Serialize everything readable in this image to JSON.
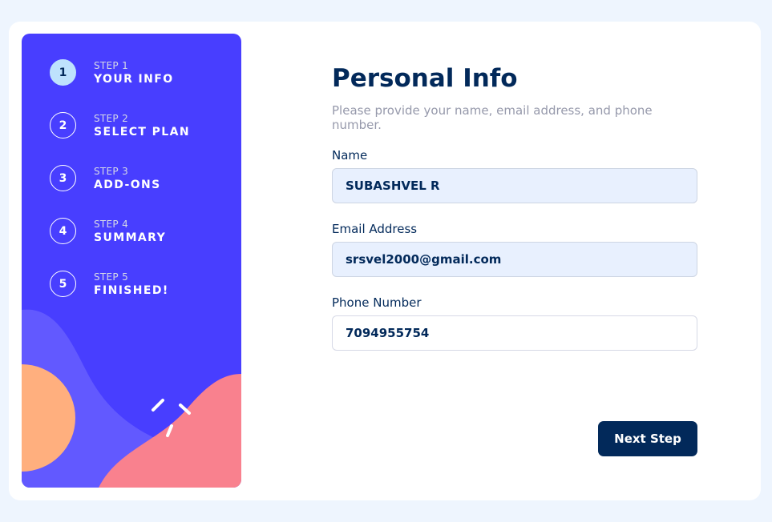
{
  "sidebar": {
    "steps": [
      {
        "num": "1",
        "sub": "STEP 1",
        "title": "YOUR INFO"
      },
      {
        "num": "2",
        "sub": "STEP 2",
        "title": "SELECT PLAN"
      },
      {
        "num": "3",
        "sub": "STEP 3",
        "title": "ADD-ONS"
      },
      {
        "num": "4",
        "sub": "STEP 4",
        "title": "SUMMARY"
      },
      {
        "num": "5",
        "sub": "STEP 5",
        "title": "FINISHED!"
      }
    ],
    "active_step": 1
  },
  "main": {
    "title": "Personal Info",
    "subtitle": "Please provide your name, email address, and phone number.",
    "fields": {
      "name": {
        "label": "Name",
        "value": "SUBASHVEL R"
      },
      "email": {
        "label": "Email Address",
        "value": "srsvel2000@gmail.com"
      },
      "phone": {
        "label": "Phone Number",
        "value": "7094955754"
      }
    },
    "next_label": "Next Step"
  },
  "colors": {
    "sidebar_bg": "#483eff",
    "active_step_bg": "#bee2fd",
    "marine_blue": "#02295a",
    "orange": "#ffaf7e",
    "pink": "#f9818e",
    "purple_light": "#6259ff"
  }
}
